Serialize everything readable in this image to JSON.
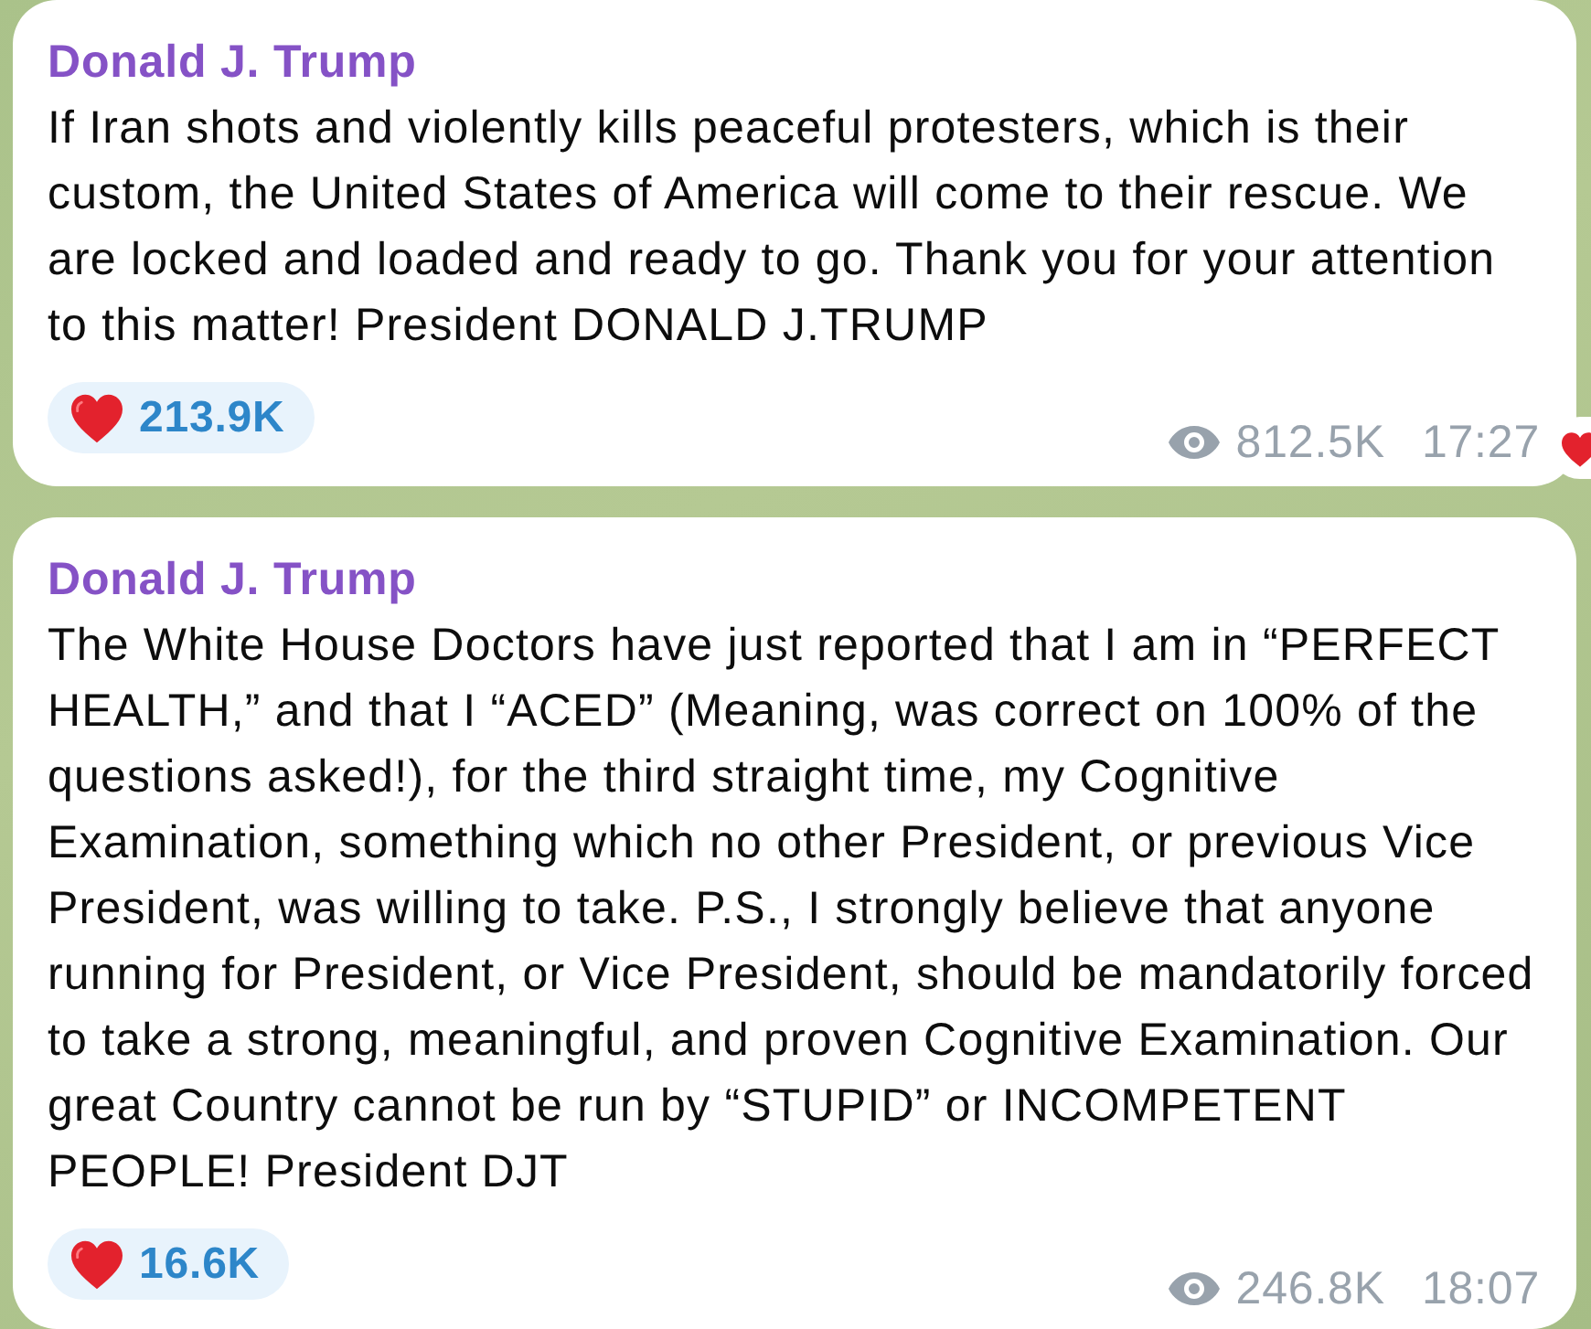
{
  "messages": [
    {
      "author": "Donald J. Trump",
      "text": "If Iran shots and violently kills peaceful protesters, which is their custom, the United States of America will come to their rescue. We are locked and loaded and ready to go. Thank you for your attention to this matter! President DONALD J.TRUMP",
      "reaction": {
        "count": "213.9K"
      },
      "views": "812.5K",
      "time": "17:27",
      "reaction_marker": true
    },
    {
      "author": "Donald J. Trump",
      "text": "The White House Doctors have just reported that I am in “PERFECT HEALTH,” and that I “ACED” (Meaning, was correct on 100% of the questions asked!), for the third straight time, my Cognitive Examination, something which no other President, or previous Vice President, was willing to take. P.S., I strongly believe that anyone running for President, or Vice President, should be mandatorily forced to take a strong, meaningful, and proven Cognitive Examination. Our great Country cannot be run by “STUPID” or INCOMPETENT PEOPLE! President DJT",
      "reaction": {
        "count": "16.6K"
      },
      "views": "246.8K",
      "time": "18:07",
      "reaction_marker": false
    }
  ]
}
